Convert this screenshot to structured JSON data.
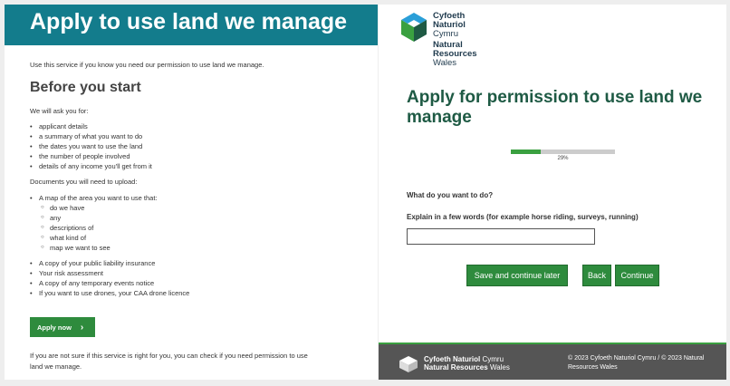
{
  "left": {
    "banner_title": "Apply to use land we manage",
    "intro": "Use this service if you know you need our permission to use land we manage.",
    "heading": "Before you start",
    "ask_intro": "We will ask you for:",
    "ask_items": [
      "applicant details",
      "a summary of what you want to do",
      "the dates you want to use the land",
      "the number of people involved",
      "details of any income you'll get from it"
    ],
    "docs_intro": "Documents you will need to upload:",
    "map_item": "A map of the area you want to use that:",
    "map_subitems": [
      "do we have",
      "any",
      "descriptions of",
      "what kind of",
      "map we want to see"
    ],
    "doc_items": [
      "A copy of your public liability insurance",
      "Your risk assessment",
      "A copy of any temporary events notice",
      "If you want to use drones, your CAA drone licence"
    ],
    "apply_button": "Apply now",
    "footer_note": "If you are not sure if this service is right for you, you can check if you need permission to use land we manage."
  },
  "right": {
    "logo": {
      "line1": "Cyfoeth",
      "line2": "Naturiol",
      "line3": "Cymru",
      "line4": "Natural",
      "line5": "Resources",
      "line6": "Wales"
    },
    "title": "Apply for permission to use land we manage",
    "progress": 0.29,
    "progress_label": "29%",
    "question1": "What do you want to do?",
    "question2": "Explain in a few words (for example horse riding, surveys, running)",
    "answer_value": "",
    "save_button": "Save and continue later",
    "back_button": "Back",
    "continue_button": "Continue",
    "footer": {
      "brand_line1_bold": "Cyfoeth Naturiol",
      "brand_line1_light": "Cymru",
      "brand_line2_bold": "Natural Resources",
      "brand_line2_light": "Wales",
      "copyright": "© 2023 Cyfoeth Naturiol Cymru / © 2023 Natural Resources Wales"
    }
  },
  "colors": {
    "banner": "#137c8c",
    "title_green": "#1e5a44",
    "button_green": "#2e8b3d",
    "progress_green": "#3aa040",
    "footer_bg": "#555555"
  }
}
